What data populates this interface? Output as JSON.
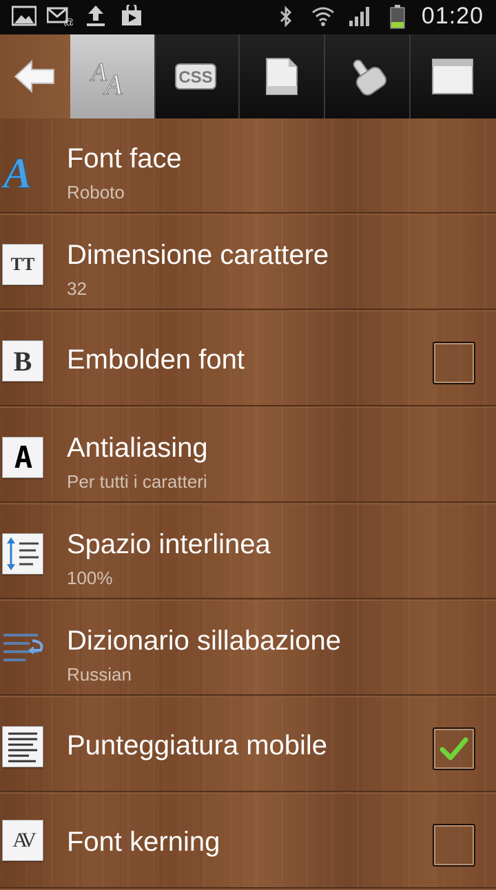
{
  "status_bar": {
    "time": "01:20",
    "left_icons": [
      "gallery-icon",
      "email-icon",
      "upload-icon",
      "play-store-icon"
    ],
    "right_icons": [
      "bluetooth-icon",
      "wifi-icon",
      "signal-icon",
      "battery-icon"
    ]
  },
  "tab_bar": {
    "back_icon": "back-arrow-icon",
    "tabs": [
      {
        "icon": "font-aa-icon",
        "active": true
      },
      {
        "icon": "css-icon",
        "label": "CSS",
        "active": false
      },
      {
        "icon": "page-icon",
        "active": false
      },
      {
        "icon": "hand-tap-icon",
        "active": false
      },
      {
        "icon": "window-icon",
        "active": false
      }
    ]
  },
  "settings": [
    {
      "title": "Font face",
      "subtitle": "Roboto",
      "icon": "font-a-icon"
    },
    {
      "title": "Dimensione carattere",
      "subtitle": "32",
      "icon": "text-size-icon",
      "icon_text": "TT"
    },
    {
      "title": "Embolden font",
      "icon": "bold-icon",
      "icon_text": "B",
      "checked": false
    },
    {
      "title": "Antialiasing",
      "subtitle": "Per tutti i caratteri",
      "icon": "antialias-icon",
      "icon_text": "A"
    },
    {
      "title": "Spazio interlinea",
      "subtitle": "100%",
      "icon": "line-spacing-icon"
    },
    {
      "title": "Dizionario sillabazione",
      "subtitle": "Russian",
      "icon": "hyphenation-icon"
    },
    {
      "title": "Punteggiatura mobile",
      "icon": "text-document-icon",
      "checked": true
    },
    {
      "title": "Font kerning",
      "icon": "kerning-icon",
      "icon_text": "AV",
      "checked": false
    }
  ],
  "colors": {
    "checkmark": "#6fd33a",
    "status_bar_bg": "#0b0b0b",
    "active_tab": "#b8b8b8"
  }
}
